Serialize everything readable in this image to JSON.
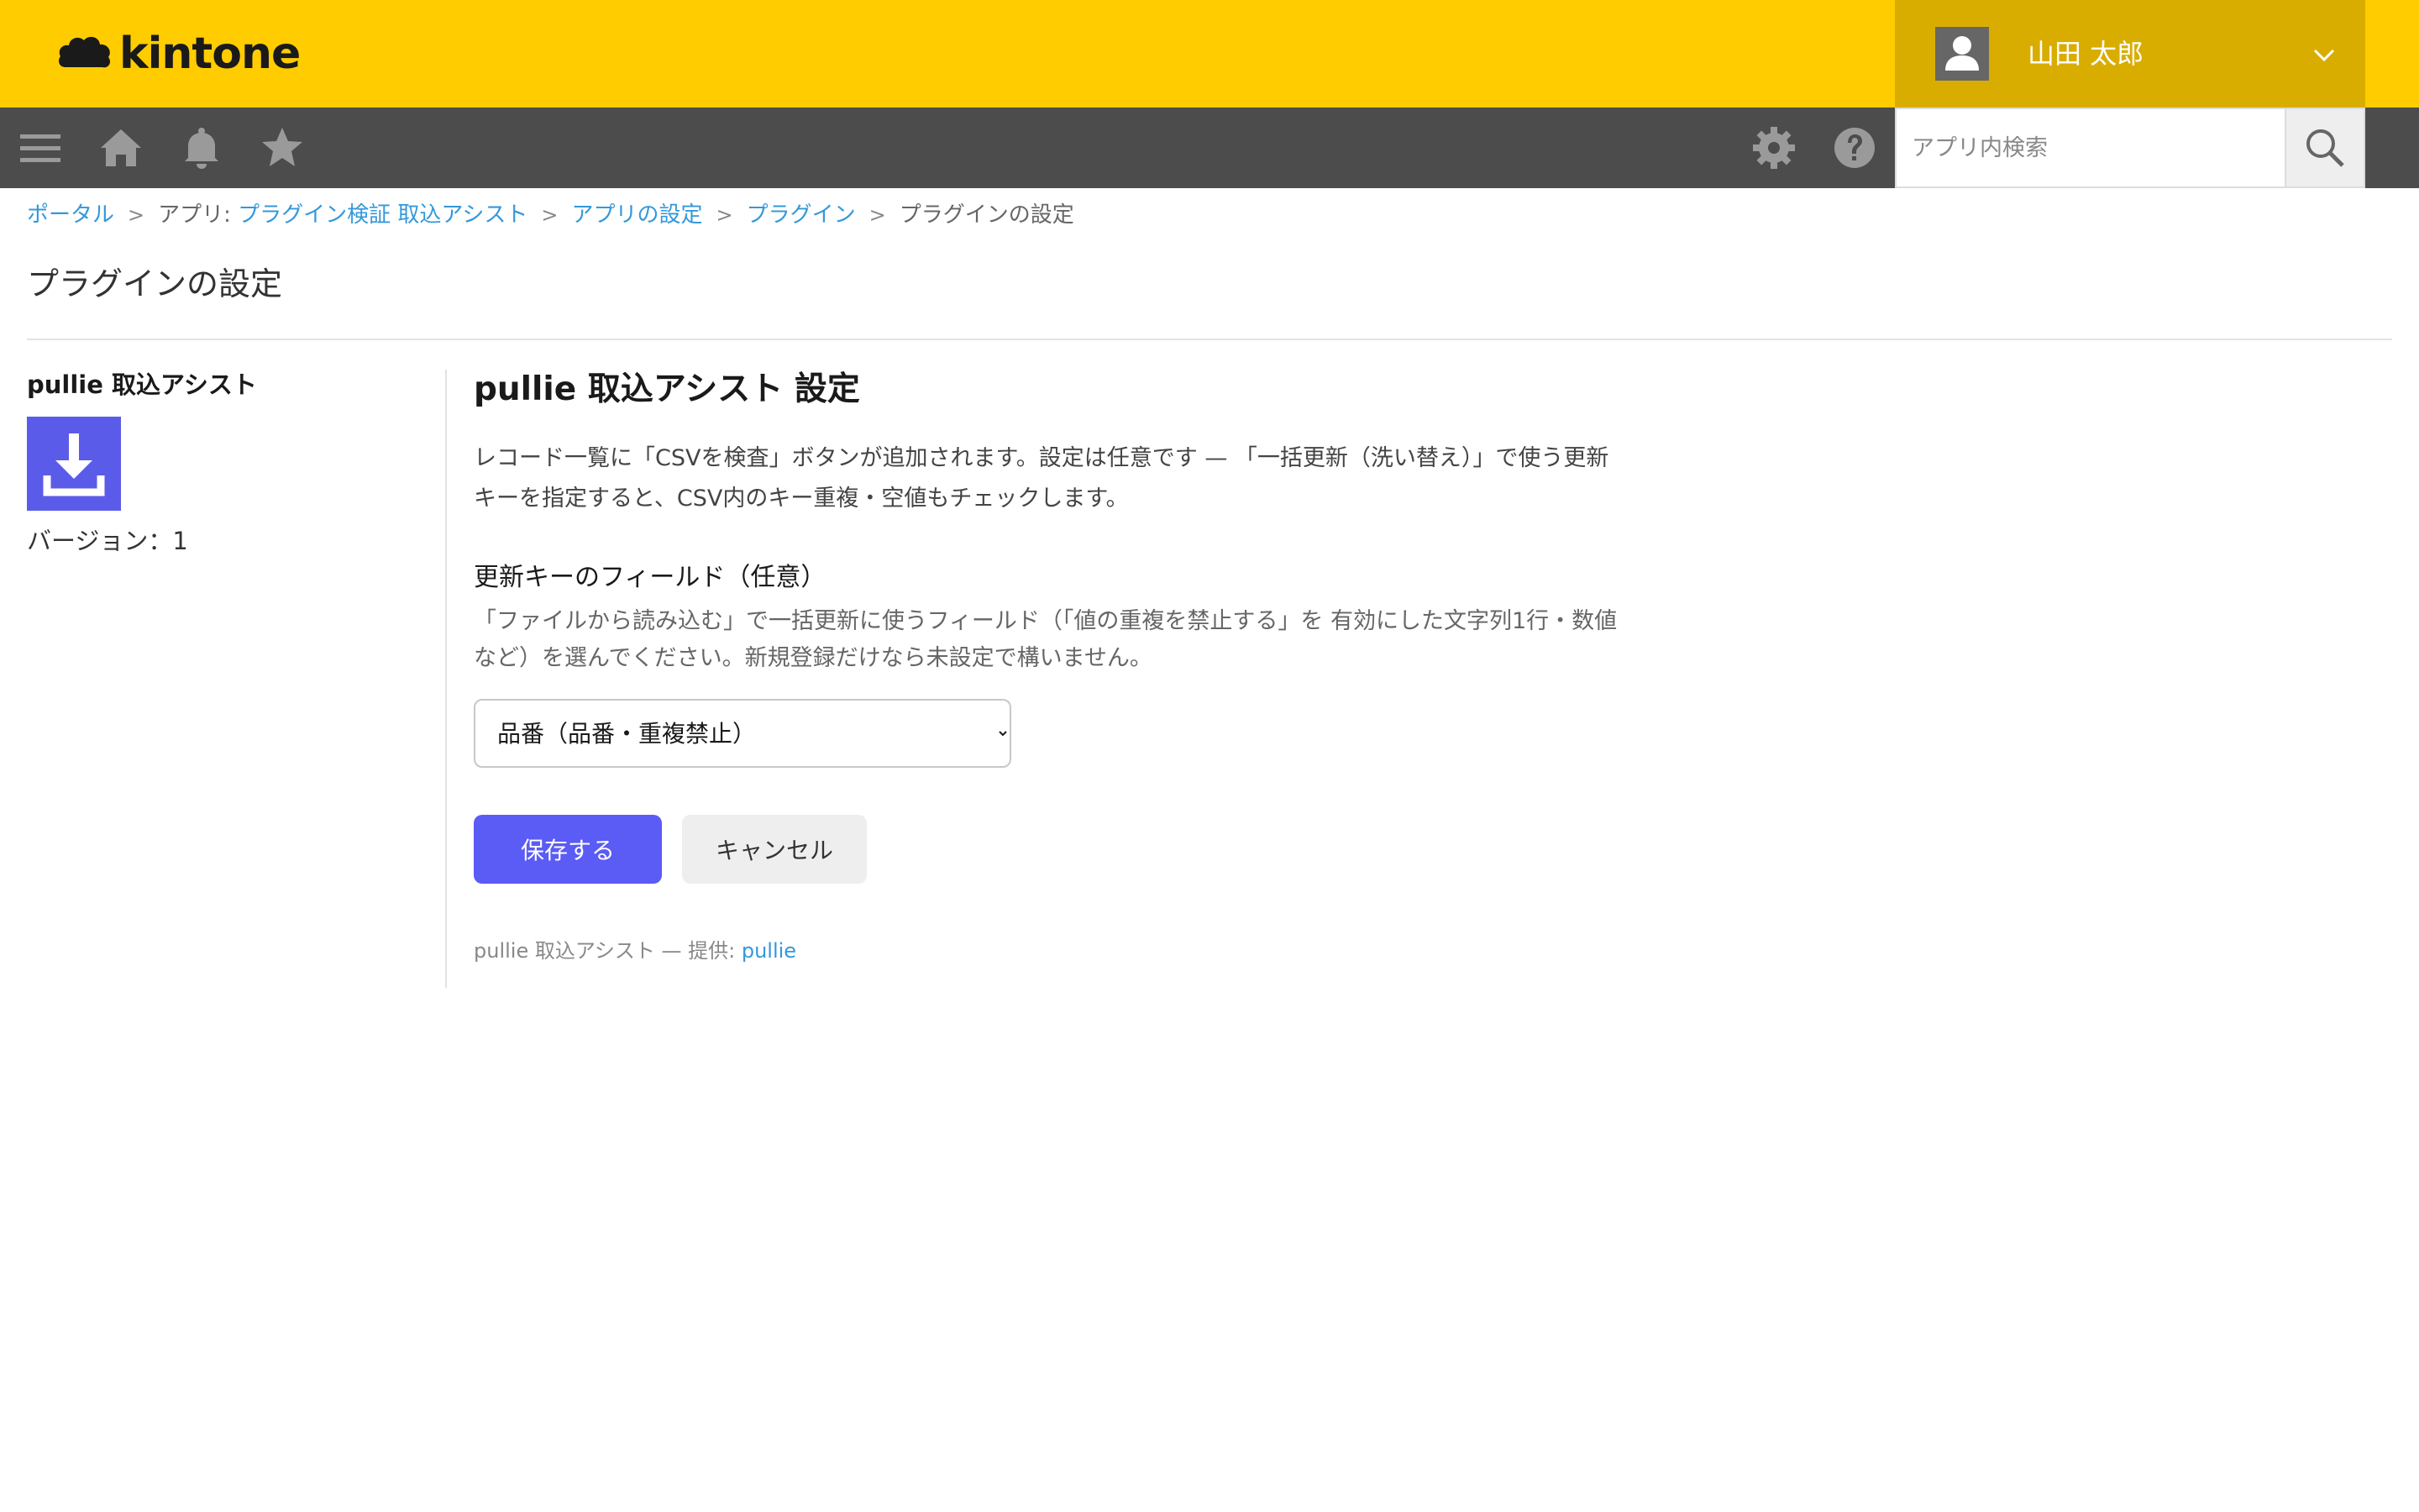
{
  "brand": {
    "logo_text": "kintone"
  },
  "header": {
    "user_name": "山田 太郎"
  },
  "navbar": {
    "icons": [
      "menu-icon",
      "home-icon",
      "bell-icon",
      "star-icon",
      "gear-icon",
      "help-icon",
      "search-icon"
    ],
    "search_placeholder": "アプリ内検索"
  },
  "breadcrumb": {
    "portal": "ポータル",
    "sep": ">",
    "app_prefix": "アプリ: ",
    "app_name": "プラグイン検証 取込アシスト",
    "app_settings": "アプリの設定",
    "plugins": "プラグイン",
    "current": "プラグインの設定"
  },
  "page": {
    "title": "プラグインの設定"
  },
  "plugin": {
    "name": "pullie 取込アシスト",
    "version": "バージョン：1",
    "icon": "download-icon",
    "icon_color": "#5b5bea"
  },
  "settings": {
    "title": "pullie 取込アシスト 設定",
    "description_line1": "レコード一覧に「CSVを検査」ボタンが追加されます。設定は任意です — 「一括更新（洗い替え）」で使う更新",
    "description_line2": "キーを指定すると、CSV内のキー重複・空値もチェックします。",
    "field_label": "更新キーのフィールド（任意）",
    "field_help_line1": "「ファイルから読み込む」で一括更新に使うフィールド（「値の重複を禁止する」を 有効にした文字列1行・数値",
    "field_help_line2": "など）を選んでください。新規登録だけなら未設定で構いません。",
    "selected_key": "品番（品番・重複禁止）",
    "save_label": "保存する",
    "cancel_label": "キャンセル",
    "save_color": "#5b5bf5"
  },
  "footer": {
    "credit_prefix": "pullie 取込アシスト — 提供: ",
    "credit_link": "pullie"
  }
}
